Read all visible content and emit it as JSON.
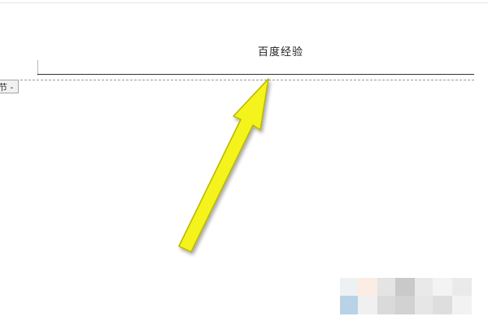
{
  "header": {
    "text": "百度经验"
  },
  "section_tab": {
    "label": "节 -"
  },
  "colors": {
    "arrow_fill": "#f4f31c",
    "arrow_stroke": "#b8b700",
    "header_line": "#333333",
    "dashed_line": "#9a9a9a"
  }
}
